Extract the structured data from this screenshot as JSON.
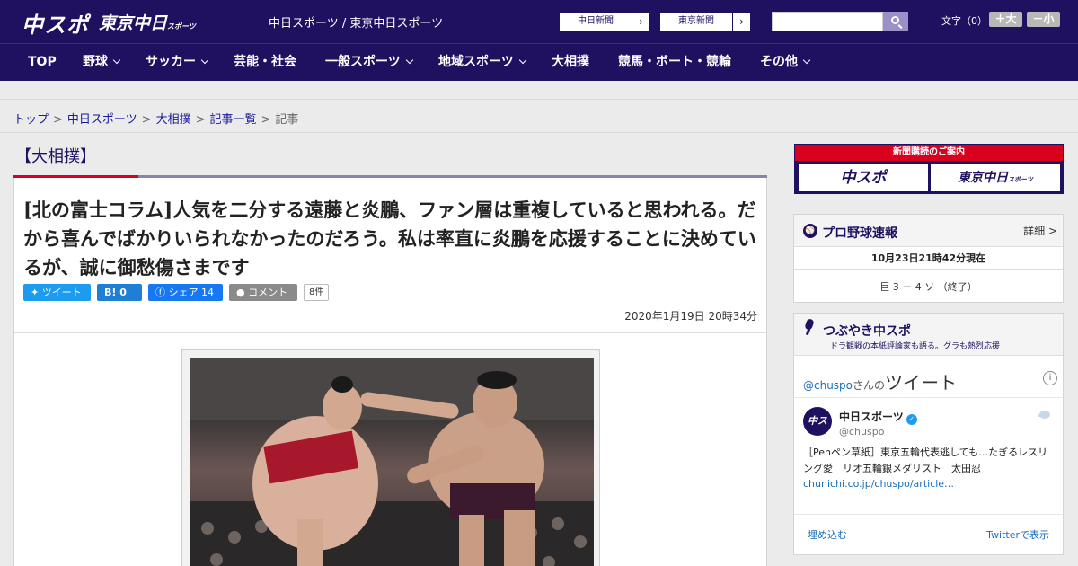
{
  "header": {
    "logo_chuspo": "中スポ",
    "logo_tokyo": "東京中日",
    "logo_tokyo_small": "スポーツ",
    "site_title": "中日スポーツ / 東京中日スポーツ",
    "paper_links": [
      "中日新聞",
      "東京新聞"
    ],
    "fontsize_label": "文字（0）",
    "font_larger": "＋大",
    "font_smaller": "－小"
  },
  "nav": {
    "items": [
      "TOP",
      "野球",
      "サッカー",
      "芸能・社会",
      "一般スポーツ",
      "地域スポーツ",
      "大相撲",
      "競馬・ボート・競輪",
      "その他"
    ]
  },
  "breadcrumb": {
    "links": [
      "トップ",
      "中日スポーツ",
      "大相撲",
      "記事一覧"
    ],
    "separator": ">",
    "current": "記事"
  },
  "article": {
    "category": "【大相撲】",
    "headline": "[北の富士コラム]人気を二分する遠藤と炎鵬、ファン層は重複していると思われる。だから喜んでばかりいられなかったのだろう。私は率直に炎鵬を応援することに決めているが、誠に御愁傷さまです",
    "share": {
      "tweet": "ツイート",
      "hatena": "B!",
      "hatena_count": "0",
      "facebook": "シェア",
      "facebook_count": "14",
      "comment": "コメント",
      "comment_count": "8件"
    },
    "date": "2020年1月19日 20時34分"
  },
  "sidebar": {
    "ad": {
      "top": "新聞購読のご案内",
      "left": "中スポ",
      "right": "東京中日",
      "right_small": "スポーツ"
    },
    "baseball": {
      "title": "プロ野球速報",
      "detail": "詳細 >",
      "time": "10月23日21時42分現在",
      "score": "巨 3 － 4 ソ （終了）"
    },
    "tweets": {
      "title": "つぶやき中スポ",
      "subtitle": "ドラ観戦の本紙評論家も語る。グラも熱烈応援",
      "by_handle": "@chuspo",
      "by_suffix": "さんの",
      "by_big": "ツイート",
      "account_name": "中日スポーツ",
      "account_handle": "@chuspo",
      "text": "［Penペン草紙］東京五輪代表逃しても…たぎるレスリング愛　リオ五輪銀メダリスト　太田忍",
      "link": "chunichi.co.jp/chuspo/article…",
      "embed": "埋め込む",
      "view": "Twitterで表示"
    }
  },
  "colors": {
    "brand_navy": "#1f1060",
    "accent_red": "#d8001c",
    "twitter_blue": "#1d9bf0",
    "facebook_blue": "#1877f2"
  }
}
